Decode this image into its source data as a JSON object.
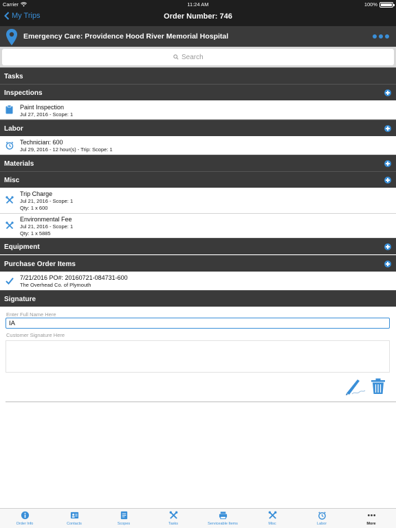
{
  "status_bar": {
    "carrier": "Carrier",
    "time": "11:24 AM",
    "battery": "100%"
  },
  "nav": {
    "back_label": "My Trips",
    "title": "Order Number: 746"
  },
  "header": {
    "location": "Emergency Care: Providence Hood River Memorial Hospital"
  },
  "search": {
    "placeholder": "Search"
  },
  "sections": {
    "tasks": "Tasks",
    "inspections": "Inspections",
    "labor": "Labor",
    "materials": "Materials",
    "misc": "Misc",
    "equipment": "Equipment",
    "purchase_order_items": "Purchase Order Items",
    "signature": "Signature"
  },
  "inspections": [
    {
      "title": "Paint Inspection",
      "detail": "Jul 27, 2016 - Scope: 1"
    }
  ],
  "labor": [
    {
      "title": "Technician: 600",
      "detail": "Jul 29, 2016 - 12 hour(s) - Trip: Scope: 1"
    }
  ],
  "misc": [
    {
      "title": "Trip Charge",
      "detail": "Jul 21, 2016 - Scope: 1",
      "qty": "Qty: 1 x 600"
    },
    {
      "title": "Environmental Fee",
      "detail": "Jul 21, 2016 - Scope: 1",
      "qty": "Qty: 1 x 5885"
    }
  ],
  "purchase_order_items": [
    {
      "title": "7/21/2016 PO#: 20160721-084731-600",
      "detail": "The Overhead Co. of Plymouth"
    }
  ],
  "signature": {
    "name_placeholder": "Enter Full Name Here",
    "name_value": "IA",
    "signature_placeholder": "Customer Signature Here"
  },
  "tabs": [
    {
      "label": "Order Info",
      "icon": "info-icon"
    },
    {
      "label": "Contacts",
      "icon": "contacts-icon"
    },
    {
      "label": "Scopes",
      "icon": "scopes-icon"
    },
    {
      "label": "Tasks",
      "icon": "tools-icon"
    },
    {
      "label": "Serviceable Items",
      "icon": "printer-icon"
    },
    {
      "label": "Misc",
      "icon": "tools-icon"
    },
    {
      "label": "Labor",
      "icon": "stopwatch-icon"
    },
    {
      "label": "More",
      "icon": "more-icon"
    }
  ],
  "colors": {
    "accent": "#3a8fd8",
    "bar_dark": "#1e1e1e",
    "section_dark": "#3a3a3a"
  }
}
